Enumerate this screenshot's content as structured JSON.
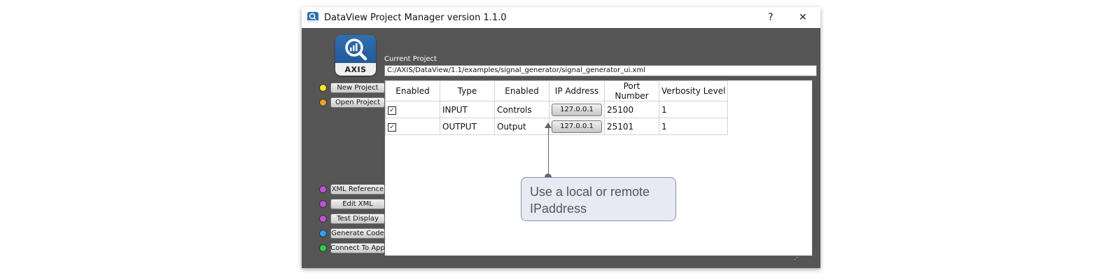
{
  "window": {
    "title": "DataView Project Manager version 1.1.0",
    "help_label": "?",
    "close_label": "✕"
  },
  "logo": {
    "text": "AXIS"
  },
  "project": {
    "label": "Current Project",
    "path": "C:/AXIS/DataView/1.1/examples/signal_generator/signal_generator_ui.xml"
  },
  "sidebar": {
    "top_buttons": [
      {
        "label": "New Project",
        "dot_color": "#f5e820"
      },
      {
        "label": "Open Project",
        "dot_color": "#f0a020"
      }
    ],
    "bottom_buttons": [
      {
        "label": "XML Reference",
        "dot_color": "#c050e0"
      },
      {
        "label": "Edit XML",
        "dot_color": "#c050e0"
      },
      {
        "label": "Test Display",
        "dot_color": "#c050e0"
      },
      {
        "label": "Generate Code",
        "dot_color": "#30a0f0"
      },
      {
        "label": "Connect To App",
        "dot_color": "#30d040"
      }
    ]
  },
  "table": {
    "headers": [
      "Enabled",
      "Type",
      "Enabled",
      "IP Address",
      "Port Number",
      "Verbosity Level"
    ],
    "rows": [
      {
        "enabled": true,
        "check": "✓",
        "type": "INPUT",
        "name": "Controls",
        "ip": "127.0.0.1",
        "port": "25100",
        "verbosity": "1"
      },
      {
        "enabled": true,
        "check": "✓",
        "type": "OUTPUT",
        "name": "Output",
        "ip": "127.0.0.1",
        "port": "25101",
        "verbosity": "1"
      }
    ]
  },
  "callout": {
    "text_line1": "Use a local or remote",
    "text_line2": "IPaddress"
  }
}
